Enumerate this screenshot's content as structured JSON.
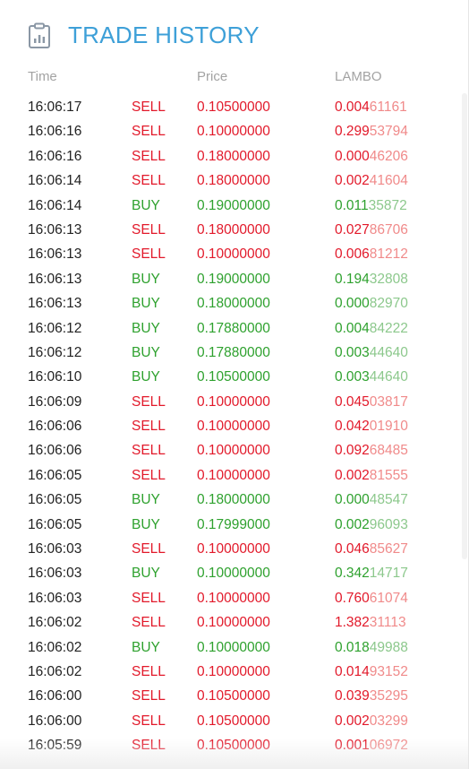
{
  "header": {
    "title": "TRADE HISTORY",
    "icon": "chart-clipboard-icon"
  },
  "columns": {
    "time": "Time",
    "price": "Price",
    "amount": "LAMBO"
  },
  "colors": {
    "title": "#3ea0d8",
    "sell": "#e2192a",
    "buy": "#2ea12e"
  },
  "trades": [
    {
      "time": "16:06:17",
      "side": "SELL",
      "price": "0.10500000",
      "amt_main": "0.004",
      "amt_tail": "61161"
    },
    {
      "time": "16:06:16",
      "side": "SELL",
      "price": "0.10000000",
      "amt_main": "0.299",
      "amt_tail": "53794"
    },
    {
      "time": "16:06:16",
      "side": "SELL",
      "price": "0.18000000",
      "amt_main": "0.000",
      "amt_tail": "46206"
    },
    {
      "time": "16:06:14",
      "side": "SELL",
      "price": "0.18000000",
      "amt_main": "0.002",
      "amt_tail": "41604"
    },
    {
      "time": "16:06:14",
      "side": "BUY",
      "price": "0.19000000",
      "amt_main": "0.011",
      "amt_tail": "35872"
    },
    {
      "time": "16:06:13",
      "side": "SELL",
      "price": "0.18000000",
      "amt_main": "0.027",
      "amt_tail": "86706"
    },
    {
      "time": "16:06:13",
      "side": "SELL",
      "price": "0.10000000",
      "amt_main": "0.006",
      "amt_tail": "81212"
    },
    {
      "time": "16:06:13",
      "side": "BUY",
      "price": "0.19000000",
      "amt_main": "0.194",
      "amt_tail": "32808"
    },
    {
      "time": "16:06:13",
      "side": "BUY",
      "price": "0.18000000",
      "amt_main": "0.000",
      "amt_tail": "82970"
    },
    {
      "time": "16:06:12",
      "side": "BUY",
      "price": "0.17880000",
      "amt_main": "0.004",
      "amt_tail": "84222"
    },
    {
      "time": "16:06:12",
      "side": "BUY",
      "price": "0.17880000",
      "amt_main": "0.003",
      "amt_tail": "44640"
    },
    {
      "time": "16:06:10",
      "side": "BUY",
      "price": "0.10500000",
      "amt_main": "0.003",
      "amt_tail": "44640"
    },
    {
      "time": "16:06:09",
      "side": "SELL",
      "price": "0.10000000",
      "amt_main": "0.045",
      "amt_tail": "03817"
    },
    {
      "time": "16:06:06",
      "side": "SELL",
      "price": "0.10000000",
      "amt_main": "0.042",
      "amt_tail": "01910"
    },
    {
      "time": "16:06:06",
      "side": "SELL",
      "price": "0.10000000",
      "amt_main": "0.092",
      "amt_tail": "68485"
    },
    {
      "time": "16:06:05",
      "side": "SELL",
      "price": "0.10000000",
      "amt_main": "0.002",
      "amt_tail": "81555"
    },
    {
      "time": "16:06:05",
      "side": "BUY",
      "price": "0.18000000",
      "amt_main": "0.000",
      "amt_tail": "48547"
    },
    {
      "time": "16:06:05",
      "side": "BUY",
      "price": "0.17999000",
      "amt_main": "0.002",
      "amt_tail": "96093"
    },
    {
      "time": "16:06:03",
      "side": "SELL",
      "price": "0.10000000",
      "amt_main": "0.046",
      "amt_tail": "85627"
    },
    {
      "time": "16:06:03",
      "side": "BUY",
      "price": "0.10000000",
      "amt_main": "0.342",
      "amt_tail": "14717"
    },
    {
      "time": "16:06:03",
      "side": "SELL",
      "price": "0.10000000",
      "amt_main": "0.760",
      "amt_tail": "61074"
    },
    {
      "time": "16:06:02",
      "side": "SELL",
      "price": "0.10000000",
      "amt_main": "1.382",
      "amt_tail": "31113"
    },
    {
      "time": "16:06:02",
      "side": "BUY",
      "price": "0.10000000",
      "amt_main": "0.018",
      "amt_tail": "49988"
    },
    {
      "time": "16:06:02",
      "side": "SELL",
      "price": "0.10000000",
      "amt_main": "0.014",
      "amt_tail": "93152"
    },
    {
      "time": "16:06:00",
      "side": "SELL",
      "price": "0.10500000",
      "amt_main": "0.039",
      "amt_tail": "35295"
    },
    {
      "time": "16:06:00",
      "side": "SELL",
      "price": "0.10500000",
      "amt_main": "0.002",
      "amt_tail": "03299"
    },
    {
      "time": "16:05:59",
      "side": "SELL",
      "price": "0.10500000",
      "amt_main": "0.001",
      "amt_tail": "06972"
    }
  ]
}
